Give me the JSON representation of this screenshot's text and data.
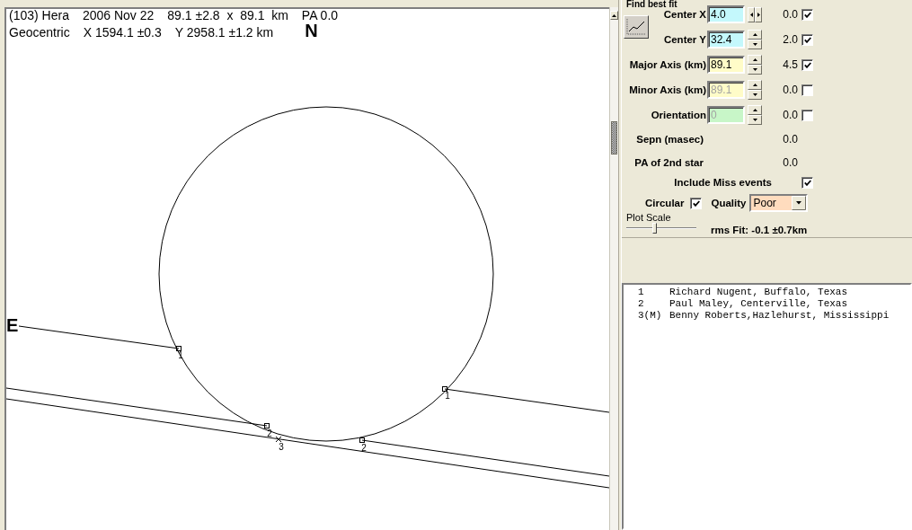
{
  "plot": {
    "header": {
      "object": "(103) Hera",
      "date": "2006 Nov 22",
      "size": "89.1 ±2.8  x  89.1  km",
      "position_angle": "PA 0.0",
      "frame": "Geocentric",
      "x_offset": "X 1594.1 ±0.3",
      "y_offset": "Y 2958.1 ±1.2 km"
    },
    "north_label": "N",
    "east_label": "E",
    "chords": [
      {
        "kind": "hit",
        "event_labels": [
          "1",
          "1"
        ]
      },
      {
        "kind": "hit",
        "event_labels": [
          "2",
          "2"
        ]
      },
      {
        "kind": "miss",
        "event_labels": [
          "3"
        ]
      }
    ]
  },
  "fit_panel": {
    "title": "Find best fit",
    "parameters": [
      {
        "label": "Center X",
        "value": "4.0",
        "color": "#c4f8fc",
        "disabled": false,
        "kind": "horizontal",
        "reading": "0.0",
        "checked": true
      },
      {
        "label": "Center Y",
        "value": "32.4",
        "color": "#c4f8fc",
        "disabled": false,
        "kind": "vertical",
        "reading": "2.0",
        "checked": true
      },
      {
        "label": "Major Axis (km)",
        "value": "89.1",
        "color": "#fffcc8",
        "disabled": false,
        "kind": "vertical",
        "reading": "4.5",
        "checked": true
      },
      {
        "label": "Minor Axis (km)",
        "value": "89.1",
        "color": "#fffcc8",
        "disabled": true,
        "kind": "vertical",
        "reading": "0.0",
        "checked": false
      },
      {
        "label": "Orientation",
        "value": "0",
        "color": "#c8f6c8",
        "disabled": true,
        "kind": "vertical",
        "reading": "0.0",
        "checked": false
      }
    ],
    "extra_values": [
      {
        "label": "Sepn (masec)",
        "value": "0.0"
      },
      {
        "label": "PA of 2nd star",
        "value": "0.0"
      }
    ],
    "include_miss": {
      "label": "Include Miss events",
      "checked": true
    },
    "circular": {
      "label": "Circular",
      "checked": true
    },
    "quality": {
      "label": "Quality",
      "value": "Poor"
    },
    "plot_scale": {
      "label": "Plot Scale",
      "level": 0.4
    },
    "rms_fit": "rms Fit: -0.1 ±0.7km"
  },
  "observers": [
    {
      "number": "1",
      "name": "Richard Nugent, Buffalo, Texas"
    },
    {
      "number": "2",
      "name": "Paul Maley, Centerville, Texas"
    },
    {
      "number": "3(M)",
      "name": "Benny Roberts,Hazlehurst, Mississippi"
    }
  ]
}
